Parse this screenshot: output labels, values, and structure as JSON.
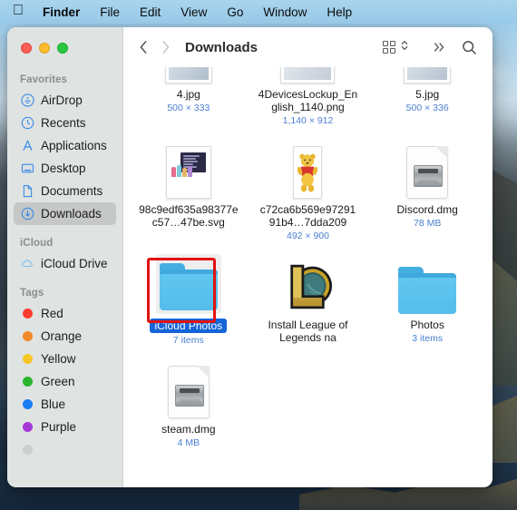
{
  "menubar": {
    "apple_icon": "apple-logo-icon",
    "items": [
      {
        "label": "Finder",
        "bold": true
      },
      {
        "label": "File",
        "bold": false
      },
      {
        "label": "Edit",
        "bold": false
      },
      {
        "label": "View",
        "bold": false
      },
      {
        "label": "Go",
        "bold": false
      },
      {
        "label": "Window",
        "bold": false
      },
      {
        "label": "Help",
        "bold": false
      }
    ]
  },
  "window": {
    "traffic_lights": [
      "close",
      "minimize",
      "zoom"
    ]
  },
  "toolbar": {
    "back_icon": "chevron-left-icon",
    "forward_icon": "chevron-right-icon",
    "title": "Downloads",
    "view_icon": "icon-view-grid-icon",
    "stepper_icon": "chevron-up-down-icon",
    "overflow_icon": "double-chevron-right-icon",
    "search_icon": "search-icon"
  },
  "sidebar": {
    "sections": [
      {
        "header": "Favorites",
        "items": [
          {
            "label": "AirDrop",
            "icon": "airdrop-icon",
            "selected": false
          },
          {
            "label": "Recents",
            "icon": "clock-icon",
            "selected": false
          },
          {
            "label": "Applications",
            "icon": "applications-icon",
            "selected": false
          },
          {
            "label": "Desktop",
            "icon": "desktop-icon",
            "selected": false
          },
          {
            "label": "Documents",
            "icon": "document-icon",
            "selected": false
          },
          {
            "label": "Downloads",
            "icon": "download-icon",
            "selected": true
          }
        ]
      },
      {
        "header": "iCloud",
        "items": [
          {
            "label": "iCloud Drive",
            "icon": "cloud-icon",
            "selected": false
          }
        ]
      },
      {
        "header": "Tags",
        "items": [
          {
            "label": "Red",
            "icon": "tag-dot-icon",
            "color": "#fc3b30",
            "selected": false
          },
          {
            "label": "Orange",
            "icon": "tag-dot-icon",
            "color": "#f2892a",
            "selected": false
          },
          {
            "label": "Yellow",
            "icon": "tag-dot-icon",
            "color": "#f6c726",
            "selected": false
          },
          {
            "label": "Green",
            "icon": "tag-dot-icon",
            "color": "#29b52e",
            "selected": false
          },
          {
            "label": "Blue",
            "icon": "tag-dot-icon",
            "color": "#1a7df5",
            "selected": false
          },
          {
            "label": "Purple",
            "icon": "tag-dot-icon",
            "color": "#a537d6",
            "selected": false
          }
        ]
      }
    ]
  },
  "files": [
    {
      "name": "4.jpg",
      "meta": "500 × 333",
      "kind": "image",
      "selected": false
    },
    {
      "name": "4DevicesLockup_English_1140.png",
      "meta": "1,140 × 912",
      "kind": "image",
      "selected": false
    },
    {
      "name": "5.jpg",
      "meta": "500 × 336",
      "kind": "image",
      "selected": false
    },
    {
      "name": "98c9edf635a98377ec57…47be.svg",
      "meta": "",
      "kind": "svg",
      "selected": false
    },
    {
      "name": "c72ca6b569e9729191b4…7dda209",
      "meta": "492 × 900",
      "kind": "pooh",
      "selected": false
    },
    {
      "name": "Discord.dmg",
      "meta": "78 MB",
      "kind": "dmg",
      "selected": false
    },
    {
      "name": "iCloud Photos",
      "meta": "7 items",
      "kind": "folder",
      "selected": true
    },
    {
      "name": "Install League of Legends na",
      "meta": "",
      "kind": "lol",
      "selected": false
    },
    {
      "name": "Photos",
      "meta": "3 items",
      "kind": "folder",
      "selected": false
    },
    {
      "name": "steam.dmg",
      "meta": "4 MB",
      "kind": "dmg",
      "selected": false
    }
  ],
  "annotation": {
    "shape": "rectangle",
    "color": "#e0120f",
    "targets": "iCloud Photos"
  },
  "colors": {
    "selection_blue": "#1565d8",
    "meta_blue": "#4a7fd0",
    "sidebar_bg": "#dfe3e2",
    "menubar_bg": "#96c9e8"
  }
}
